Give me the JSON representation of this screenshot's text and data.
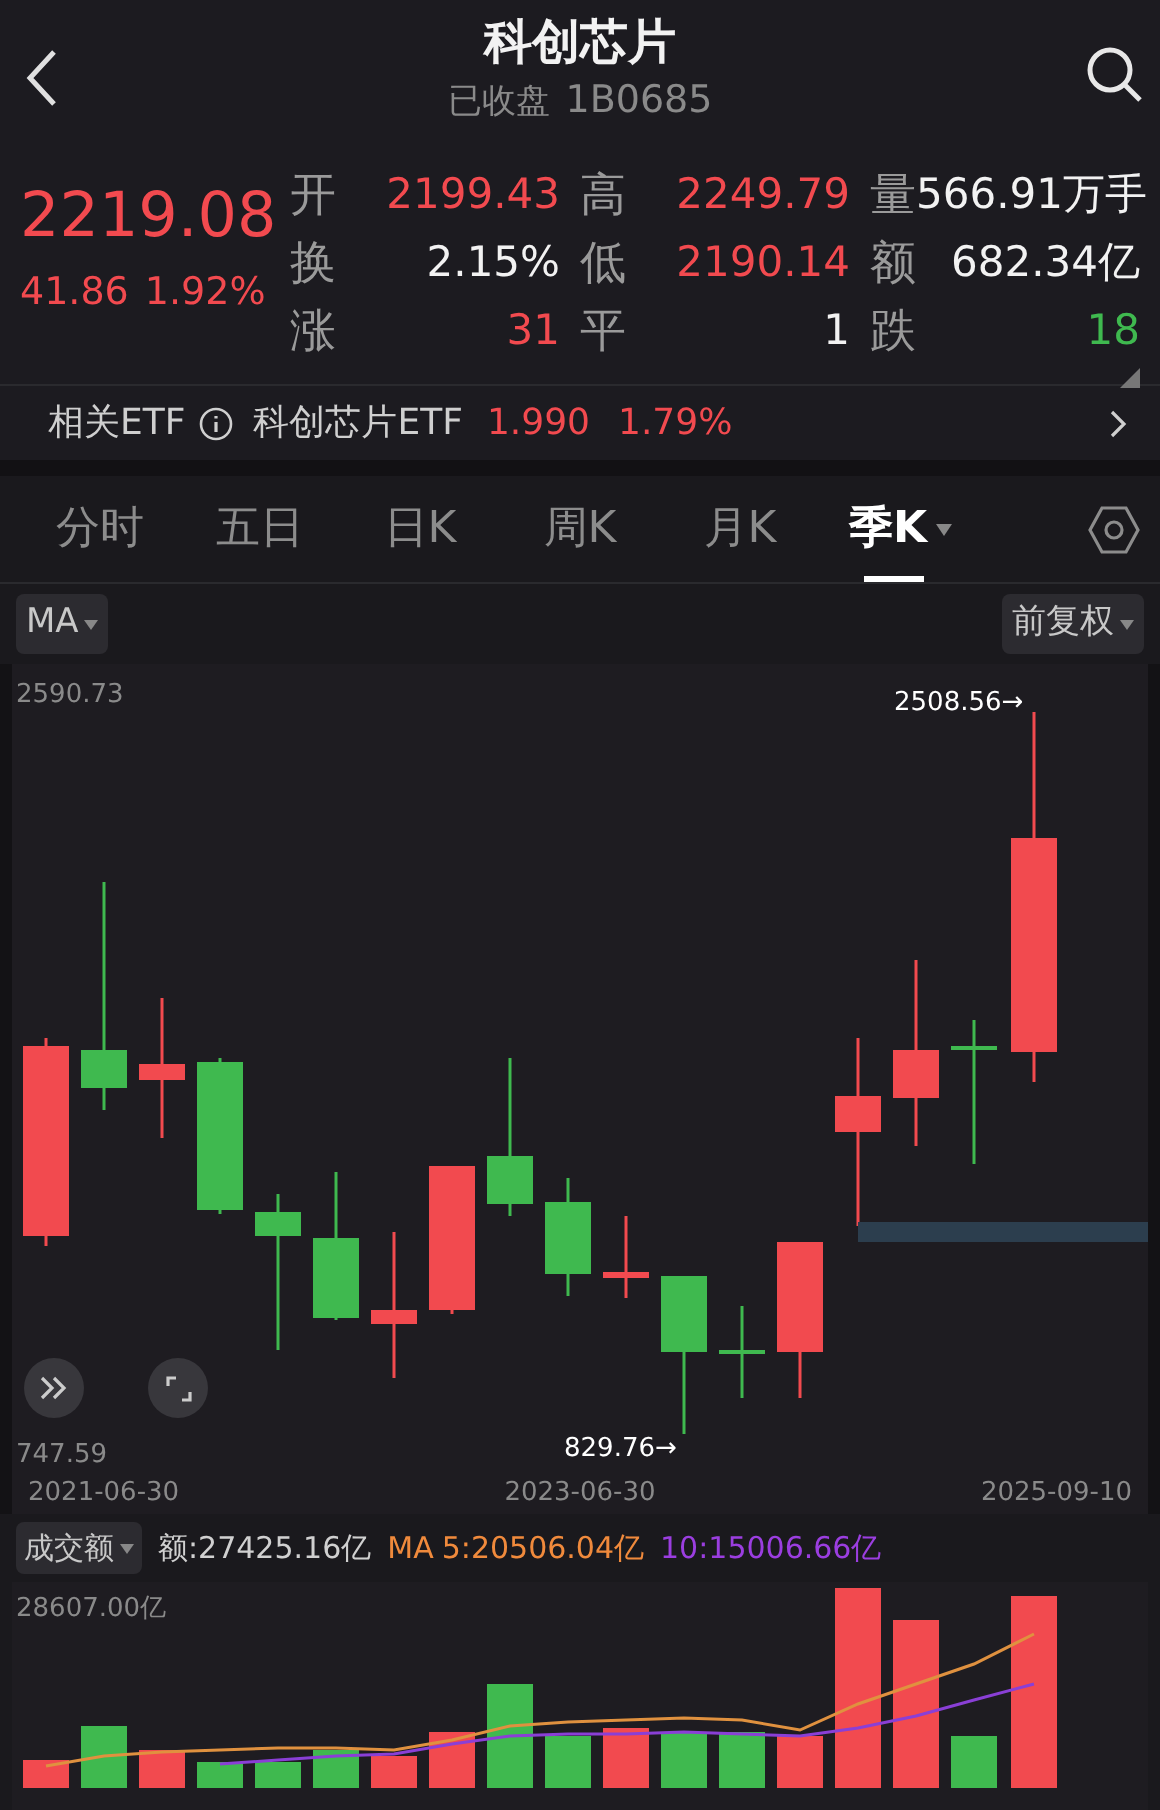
{
  "header": {
    "title": "科创芯片",
    "status": "已收盘",
    "code": "1B0685"
  },
  "quote": {
    "price": "2219.08",
    "change": "41.86",
    "change_pct": "1.92%"
  },
  "stats": [
    {
      "label": "开",
      "value": "2199.43",
      "color": "#f24a4f"
    },
    {
      "label": "高",
      "value": "2249.79",
      "color": "#f24a4f"
    },
    {
      "label": "量",
      "value": "566.91万手",
      "color": "#f2f2f2"
    },
    {
      "label": "换",
      "value": "2.15%",
      "color": "#f2f2f2"
    },
    {
      "label": "低",
      "value": "2190.14",
      "color": "#f24a4f"
    },
    {
      "label": "额",
      "value": "682.34亿",
      "color": "#f2f2f2"
    },
    {
      "label": "涨",
      "value": "31",
      "color": "#f24a4f"
    },
    {
      "label": "平",
      "value": "1",
      "color": "#f2f2f2"
    },
    {
      "label": "跌",
      "value": "18",
      "color": "#3fb94f"
    }
  ],
  "etf": {
    "label": "相关ETF",
    "name": "科创芯片ETF",
    "price": "1.990",
    "change_pct": "1.79%"
  },
  "tabs": [
    {
      "label": "分时",
      "selected": false
    },
    {
      "label": "五日",
      "selected": false
    },
    {
      "label": "日K",
      "selected": false
    },
    {
      "label": "周K",
      "selected": false
    },
    {
      "label": "月K",
      "selected": false
    },
    {
      "label": "季K",
      "selected": true
    }
  ],
  "chart_toolbar": {
    "indicator": "MA",
    "adjust": "前复权"
  },
  "price_chart": {
    "max_label": "2590.73",
    "min_label": "747.59",
    "high_marker": "2508.56→",
    "low_marker": "829.76→",
    "dates": [
      "2021-06-30",
      "2023-06-30",
      "2025-09-10"
    ]
  },
  "volume": {
    "selector": "成交额",
    "amount": "额:27425.16亿",
    "ma_label": "MA",
    "ma5": "5:20506.04亿",
    "ma10": "10:15006.66亿",
    "max_label": "28607.00亿"
  }
}
